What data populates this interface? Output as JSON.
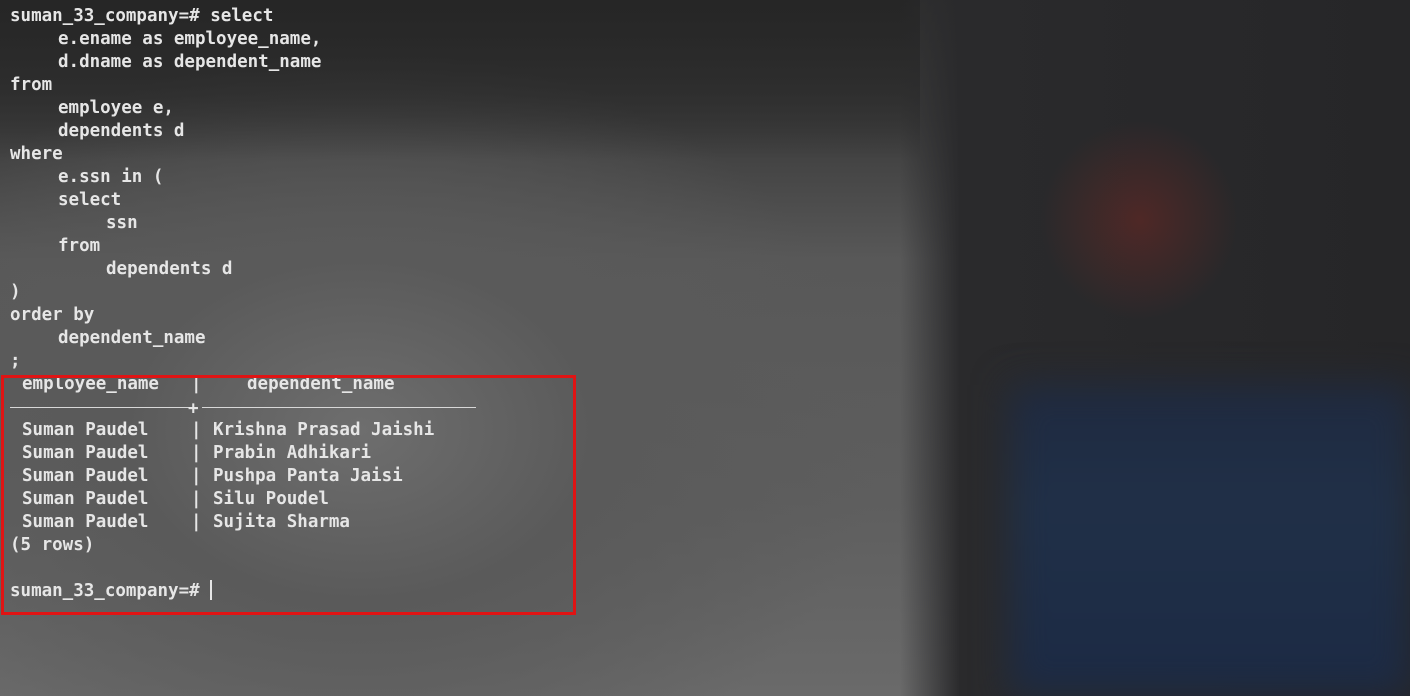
{
  "prompt": "suman_33_company=#",
  "query_lines": [
    "select",
    "e.ename as employee_name,",
    "d.dname as dependent_name",
    "from",
    "employee e,",
    "dependents d",
    "where",
    "e.ssn in (",
    "select",
    "ssn",
    "from",
    "dependents d",
    ")",
    "order by",
    "dependent_name",
    ";"
  ],
  "result": {
    "columns": [
      "employee_name",
      "dependent_name"
    ],
    "rows": [
      [
        "Suman Paudel",
        "Krishna Prasad Jaishi"
      ],
      [
        "Suman Paudel",
        "Prabin Adhikari"
      ],
      [
        "Suman Paudel",
        "Pushpa Panta Jaisi"
      ],
      [
        "Suman Paudel",
        "Silu Poudel"
      ],
      [
        "Suman Paudel",
        "Sujita Sharma"
      ]
    ],
    "row_count": "(5 rows)"
  },
  "colors": {
    "text": "#e6e6e6",
    "highlight_border": "#e01414"
  }
}
